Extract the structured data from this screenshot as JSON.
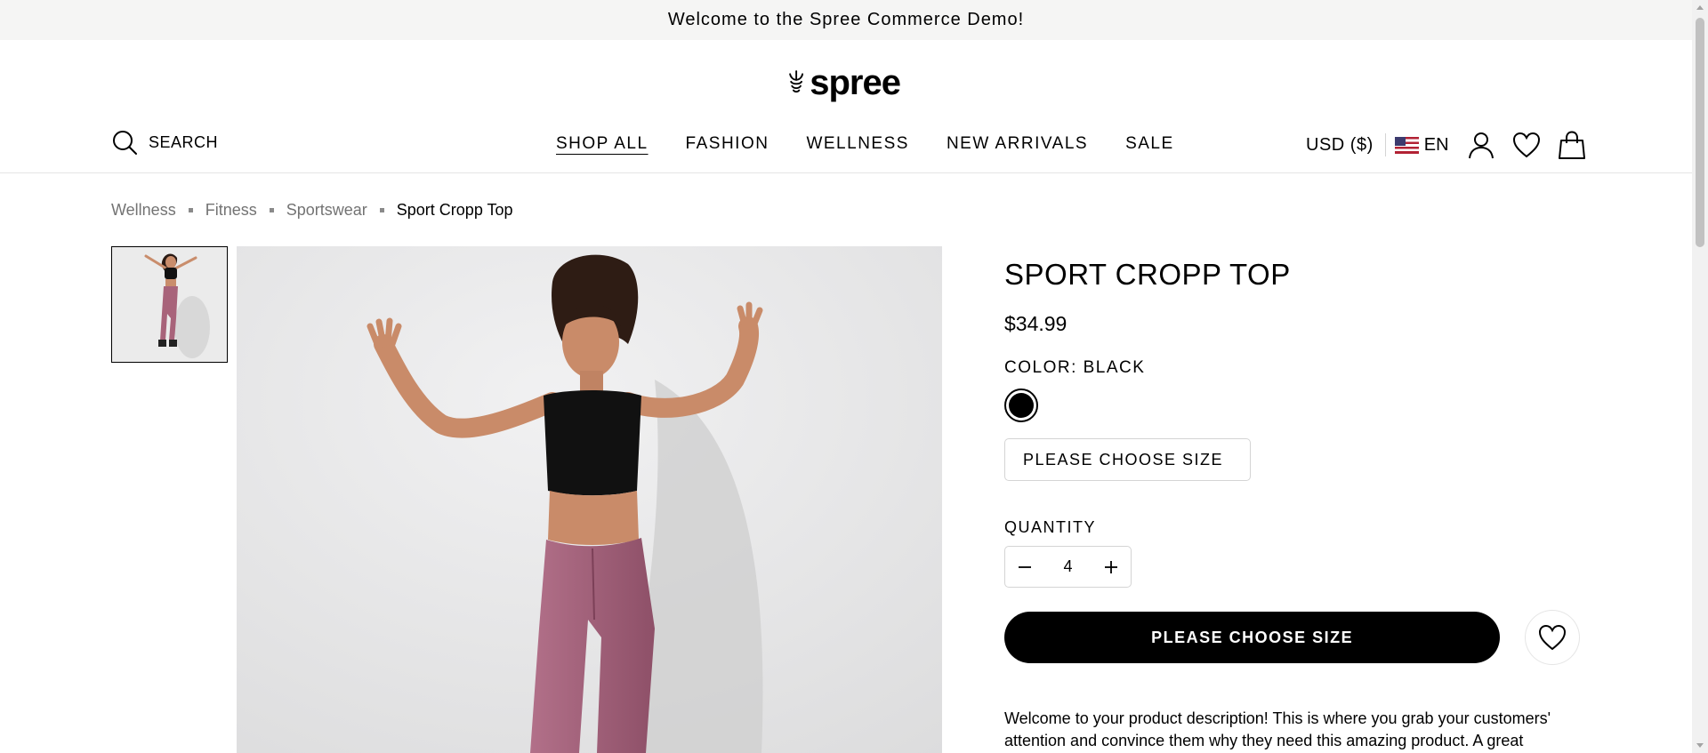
{
  "announcement": {
    "text": "Welcome to the Spree Commerce Demo!"
  },
  "header": {
    "logo_text": "spree",
    "search_label": "SEARCH",
    "nav": [
      {
        "label": "SHOP ALL",
        "active": true
      },
      {
        "label": "FASHION"
      },
      {
        "label": "WELLNESS"
      },
      {
        "label": "NEW ARRIVALS"
      },
      {
        "label": "SALE"
      }
    ],
    "currency": "USD ($)",
    "language": "EN",
    "icons": [
      "search-icon",
      "us-flag-icon",
      "account-icon",
      "wishlist-icon",
      "cart-icon"
    ]
  },
  "breadcrumb": {
    "items": [
      "Wellness",
      "Fitness",
      "Sportswear"
    ],
    "current": "Sport Cropp Top"
  },
  "product": {
    "title": "SPORT CROPP TOP",
    "price": "$34.99",
    "color_label": "COLOR: BLACK",
    "swatch_color": "#000000",
    "size_placeholder": "PLEASE CHOOSE SIZE",
    "quantity_label": "QUANTITY",
    "quantity": "4",
    "add_button_label": "PLEASE CHOOSE SIZE",
    "description": "Welcome to your product description! This is where you grab your customers' attention and convince them why they need this amazing product. A great"
  },
  "colors": {
    "announcement_bg": "#f5f5f4",
    "primary": "#000000",
    "muted_text": "#737373",
    "border": "#d4d4d4"
  }
}
